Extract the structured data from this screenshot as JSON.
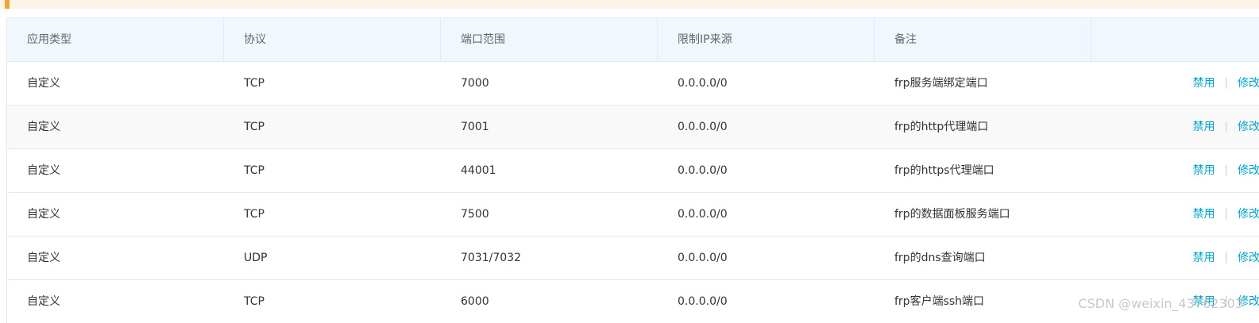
{
  "columns": [
    "应用类型",
    "协议",
    "端口范围",
    "限制IP来源",
    "备注",
    ""
  ],
  "rows": [
    {
      "type": "自定义",
      "protocol": "TCP",
      "port": "7000",
      "source": "0.0.0.0/0",
      "note": "frp服务端绑定端口",
      "disable": "禁用",
      "edit": "修改"
    },
    {
      "type": "自定义",
      "protocol": "TCP",
      "port": "7001",
      "source": "0.0.0.0/0",
      "note": "frp的http代理端口",
      "disable": "禁用",
      "edit": "修改"
    },
    {
      "type": "自定义",
      "protocol": "TCP",
      "port": "44001",
      "source": "0.0.0.0/0",
      "note": "frp的https代理端口",
      "disable": "禁用",
      "edit": "修改"
    },
    {
      "type": "自定义",
      "protocol": "TCP",
      "port": "7500",
      "source": "0.0.0.0/0",
      "note": "frp的数据面板服务端口",
      "disable": "禁用",
      "edit": "修改"
    },
    {
      "type": "自定义",
      "protocol": "UDP",
      "port": "7031/7032",
      "source": "0.0.0.0/0",
      "note": "frp的dns查询端口",
      "disable": "禁用",
      "edit": "修改"
    },
    {
      "type": "自定义",
      "protocol": "TCP",
      "port": "6000",
      "source": "0.0.0.0/0",
      "note": "frp客户端ssh端口",
      "disable": "禁用",
      "edit": "修改"
    }
  ],
  "separator": "|",
  "watermark": "CSDN @weixin_43762303",
  "colors": {
    "header_bg": "#f0f7ff",
    "link": "#00a2ca",
    "banner_bg": "#fdf3e7",
    "banner_accent": "#f2a33a"
  }
}
